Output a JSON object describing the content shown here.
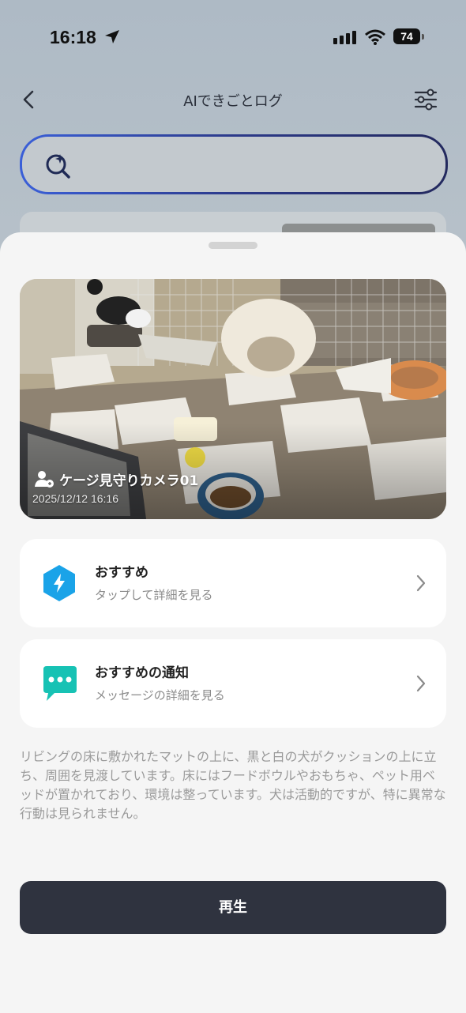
{
  "status_bar": {
    "time": "16:18",
    "battery": "74"
  },
  "header": {
    "title": "AIできごとログ"
  },
  "search": {
    "placeholder": ""
  },
  "snapshot": {
    "camera_name": "ケージ見守りカメラ01",
    "timestamp": "2025/12/12 16:16"
  },
  "cards": [
    {
      "title": "おすすめ",
      "subtitle": "タップして詳細を見る",
      "icon": "lightning-hexagon-icon",
      "color": "#1aa3e8"
    },
    {
      "title": "おすすめの通知",
      "subtitle": "メッセージの詳細を見る",
      "icon": "chat-bubble-icon",
      "color": "#17c2b4"
    }
  ],
  "summary": "リビングの床に敷かれたマットの上に、黒と白の犬がクッションの上に立ち、周囲を見渡しています。床にはフードボウルやおもちゃ、ペット用ベッドが置かれており、環境は整っています。犬は活動的ですが、特に異常な行動は見られません。",
  "play_button": {
    "label": "再生"
  }
}
